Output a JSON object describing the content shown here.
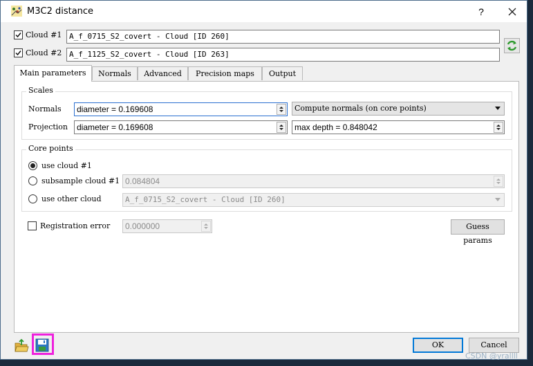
{
  "window": {
    "title": "M3C2 distance",
    "help_symbol": "?"
  },
  "clouds": {
    "cloud1": {
      "label": "Cloud #1",
      "checked": true,
      "value": "A_f_0715_S2_covert - Cloud [ID 260]"
    },
    "cloud2": {
      "label": "Cloud #2",
      "checked": true,
      "value": "A_f_1125_S2_covert - Cloud [ID 263]"
    }
  },
  "tabs": [
    {
      "label": "Main parameters",
      "active": true
    },
    {
      "label": "Normals"
    },
    {
      "label": "Advanced"
    },
    {
      "label": "Precision maps"
    },
    {
      "label": "Output"
    }
  ],
  "scales": {
    "title": "Scales",
    "normals_label": "Normals",
    "normals_diameter": "diameter = 0.169608",
    "normals_mode": "Compute normals (on core points)",
    "projection_label": "Projection",
    "projection_diameter": "diameter = 0.169608",
    "max_depth": "max depth = 0.848042"
  },
  "core_points": {
    "title": "Core points",
    "use_cloud_label": "use cloud #1",
    "subsample_label": "subsample cloud #1",
    "subsample_value": "0.084804",
    "other_cloud_label": "use other cloud",
    "other_cloud_value": "A_f_0715_S2_covert - Cloud [ID 260]",
    "selected": "use cloud #1"
  },
  "registration": {
    "label": "Registration error",
    "checked": false,
    "value": "0.000000"
  },
  "buttons": {
    "guess_params": "Guess params",
    "ok": "OK",
    "cancel": "Cancel"
  },
  "watermark": "CSDN @yrallll",
  "colors": {
    "highlight": "#ee22dd",
    "focus_border": "#2a6fd0",
    "default_button": "#0078d7"
  }
}
